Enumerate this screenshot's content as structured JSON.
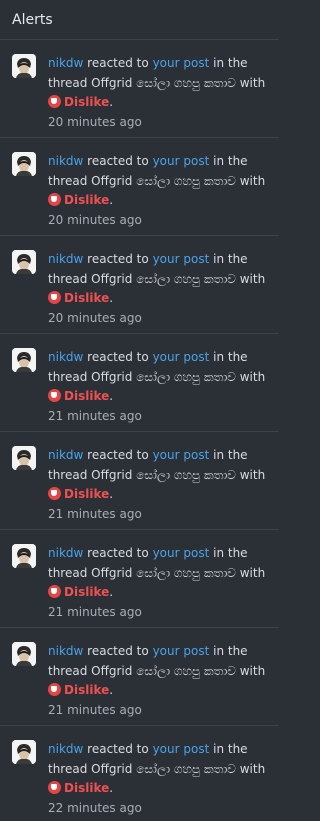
{
  "header": {
    "title": "Alerts"
  },
  "alerts": [
    {
      "user": "nikdw",
      "verb": "reacted to",
      "target": "your post",
      "in_text": "in the thread",
      "thread": "Offgrid සෝලා ගහපු කතාව",
      "with_text": "with",
      "reaction": "Dislike",
      "period": ".",
      "time": "20 minutes ago"
    },
    {
      "user": "nikdw",
      "verb": "reacted to",
      "target": "your post",
      "in_text": "in the thread",
      "thread": "Offgrid සෝලා ගහපු කතාව",
      "with_text": "with",
      "reaction": "Dislike",
      "period": ".",
      "time": "20 minutes ago"
    },
    {
      "user": "nikdw",
      "verb": "reacted to",
      "target": "your post",
      "in_text": "in the thread",
      "thread": "Offgrid සෝලා ගහපු කතාව",
      "with_text": "with",
      "reaction": "Dislike",
      "period": ".",
      "time": "20 minutes ago"
    },
    {
      "user": "nikdw",
      "verb": "reacted to",
      "target": "your post",
      "in_text": "in the thread",
      "thread": "Offgrid සෝලා ගහපු කතාව",
      "with_text": "with",
      "reaction": "Dislike",
      "period": ".",
      "time": "21 minutes ago"
    },
    {
      "user": "nikdw",
      "verb": "reacted to",
      "target": "your post",
      "in_text": "in the thread",
      "thread": "Offgrid සෝලා ගහපු කතාව",
      "with_text": "with",
      "reaction": "Dislike",
      "period": ".",
      "time": "21 minutes ago"
    },
    {
      "user": "nikdw",
      "verb": "reacted to",
      "target": "your post",
      "in_text": "in the thread",
      "thread": "Offgrid සෝලා ගහපු කතාව",
      "with_text": "with",
      "reaction": "Dislike",
      "period": ".",
      "time": "21 minutes ago"
    },
    {
      "user": "nikdw",
      "verb": "reacted to",
      "target": "your post",
      "in_text": "in the thread",
      "thread": "Offgrid සෝලා ගහපු කතාව",
      "with_text": "with",
      "reaction": "Dislike",
      "period": ".",
      "time": "21 minutes ago"
    },
    {
      "user": "nikdw",
      "verb": "reacted to",
      "target": "your post",
      "in_text": "in the thread",
      "thread": "Offgrid සෝලා ගහපු කතාව",
      "with_text": "with",
      "reaction": "Dislike",
      "period": ".",
      "time": "22 minutes ago"
    }
  ],
  "icons": {
    "reaction_icon": "dislike-icon",
    "avatar_icon": "user-avatar"
  },
  "colors": {
    "background": "#2b2f36",
    "link": "#4aa3ea",
    "dislike": "#f05050",
    "muted": "#a8afb8"
  }
}
